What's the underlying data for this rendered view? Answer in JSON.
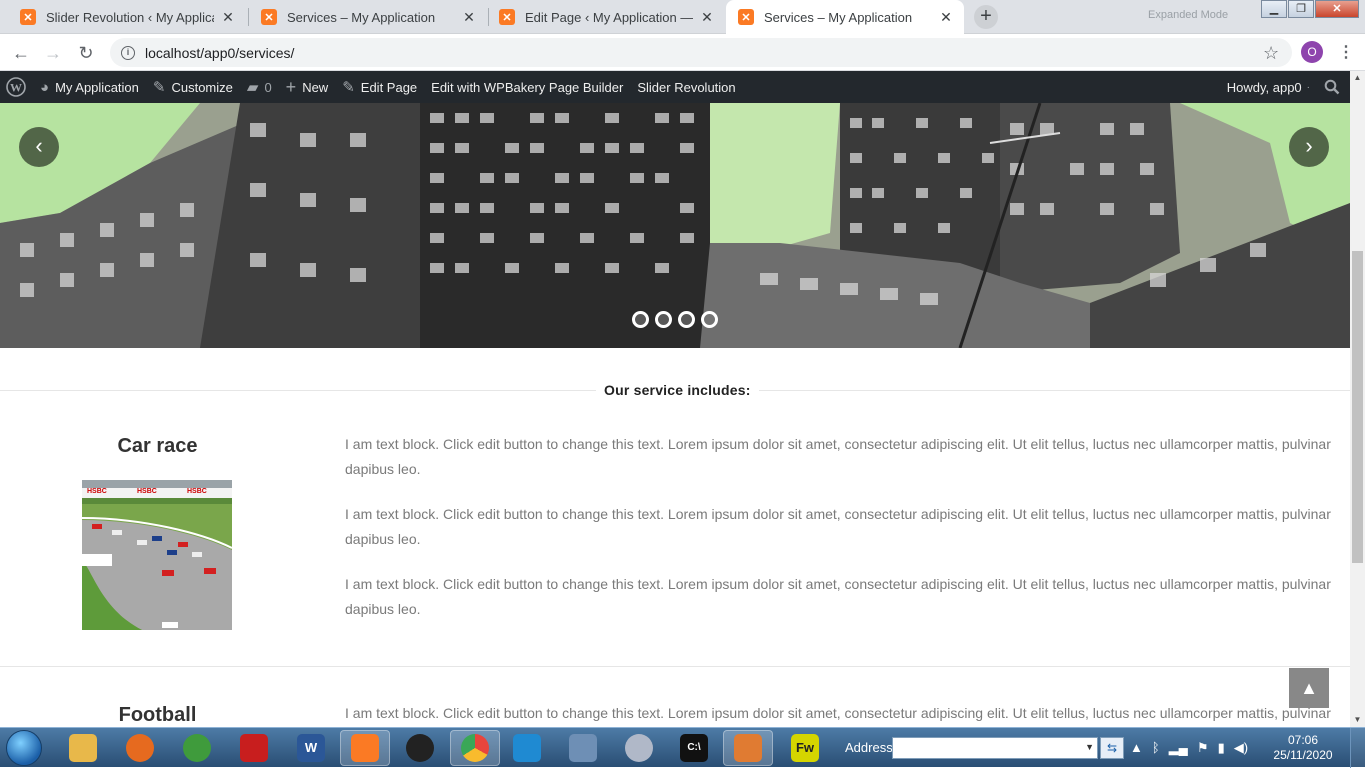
{
  "browser": {
    "tabs": [
      {
        "title": "Slider Revolution ‹ My Applicatio",
        "active": false
      },
      {
        "title": "Services – My Application",
        "active": false
      },
      {
        "title": "Edit Page ‹ My Application — Wo",
        "active": false
      },
      {
        "title": "Services – My Application",
        "active": true
      }
    ],
    "close_glyph": "✕",
    "newtab_glyph": "+",
    "profile_ghost": "Expanded Mode",
    "url": "localhost/app0/services/",
    "avatar_letter": "O",
    "window": {
      "minimize": "▁",
      "maximize": "❐",
      "close": "✕"
    }
  },
  "adminbar": {
    "site_name": "My Application",
    "customize": "Customize",
    "comments_count": "0",
    "new": "New",
    "edit_page": "Edit Page",
    "wpbakery": "Edit with WPBakery Page Builder",
    "slider_revolution": "Slider Revolution",
    "howdy": "Howdy, app0"
  },
  "slider": {
    "bullet_count": 4,
    "prev_glyph": "‹",
    "next_glyph": "›"
  },
  "content": {
    "section_title": "Our service includes:",
    "services": [
      {
        "title": "Car race",
        "paragraphs": [
          "I am text block. Click edit button to change this text. Lorem ipsum dolor sit amet, consectetur adipiscing elit. Ut elit tellus, luctus nec ullamcorper mattis, pulvinar dapibus leo.",
          "I am text block. Click edit button to change this text. Lorem ipsum dolor sit amet, consectetur adipiscing elit. Ut elit tellus, luctus nec ullamcorper mattis, pulvinar dapibus leo.",
          "I am text block. Click edit button to change this text. Lorem ipsum dolor sit amet, consectetur adipiscing elit. Ut elit tellus, luctus nec ullamcorper mattis, pulvinar dapibus leo."
        ],
        "image_banner_text": "HSBC"
      },
      {
        "title": "Football",
        "paragraphs": [
          "I am text block. Click edit button to change this text. Lorem ipsum dolor sit amet, consectetur adipiscing elit. Ut elit tellus, luctus nec ullamcorper mattis, pulvinar"
        ]
      }
    ],
    "back_to_top_glyph": "▲"
  },
  "taskbar": {
    "address_label": "Address",
    "clock_time": "07:06",
    "clock_date": "25/11/2020",
    "apps": [
      {
        "name": "explorer",
        "label": "",
        "color": "#e8b84a"
      },
      {
        "name": "firefox",
        "label": "",
        "color": "#e66a1f"
      },
      {
        "name": "android",
        "label": "",
        "color": "#3f9b3c"
      },
      {
        "name": "acrobat",
        "label": "",
        "color": "#c81e1e"
      },
      {
        "name": "word",
        "label": "W",
        "color": "#2b5797"
      },
      {
        "name": "xampp",
        "label": "",
        "color": "#fb7a24"
      },
      {
        "name": "obs",
        "label": "",
        "color": "#222222"
      },
      {
        "name": "chrome",
        "label": "",
        "color": "#e8453c"
      },
      {
        "name": "vscode",
        "label": "",
        "color": "#1f8ad2"
      },
      {
        "name": "file-manager",
        "label": "",
        "color": "#6e8fb5"
      },
      {
        "name": "web-tool",
        "label": "",
        "color": "#b0b8c8"
      },
      {
        "name": "cmd",
        "label": "C:\\",
        "color": "#111111"
      },
      {
        "name": "toolbox",
        "label": "",
        "color": "#e07b32"
      },
      {
        "name": "fireworks",
        "label": "Fw",
        "color": "#d5d500"
      }
    ]
  }
}
